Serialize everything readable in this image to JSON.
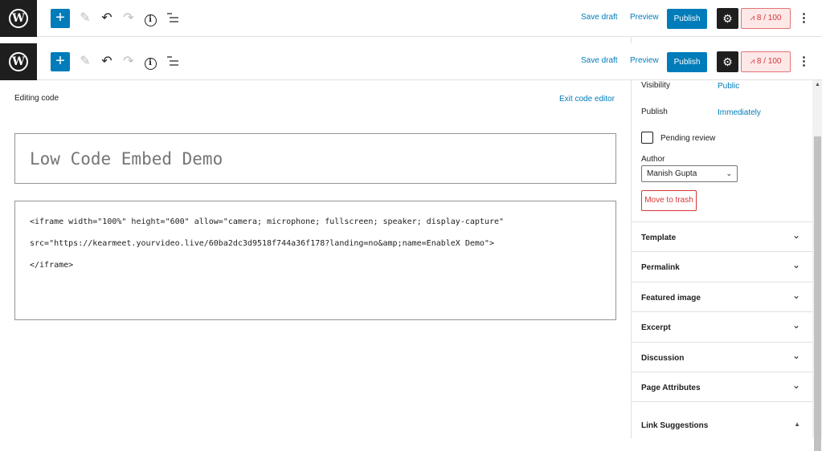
{
  "toolbar": {
    "logo_letter": "W",
    "add_symbol": "+",
    "pencil_symbol": "✎",
    "undo_symbol": "↶",
    "redo_symbol": "↷",
    "info_symbol": "i",
    "save_draft": "Save draft",
    "preview": "Preview",
    "publish": "Publish",
    "gear_symbol": "⚙",
    "score": "8 / 100",
    "more_symbol": "⋮"
  },
  "editor": {
    "mode_label": "Editing code",
    "exit_label": "Exit code editor",
    "title": "Low Code Embed Demo",
    "code_lines": [
      "<iframe width=\"100%\" height=\"600\" allow=\"camera; microphone; fullscreen; speaker; display-capture\"",
      "src=\"https://kearmeet.yourvideo.live/60ba2dc3d9518f744a36f178?landing=no&amp;name=EnableX Demo\">",
      "</iframe>"
    ]
  },
  "sidebar": {
    "visibility_label": "Visibility",
    "visibility_value": "Public",
    "publish_label": "Publish",
    "publish_value": "Immediately",
    "pending_label": "Pending review",
    "author_label": "Author",
    "author_value": "Manish Gupta",
    "trash_label": "Move to trash",
    "panels": [
      {
        "label": "Template"
      },
      {
        "label": "Permalink"
      },
      {
        "label": "Featured image"
      },
      {
        "label": "Excerpt"
      },
      {
        "label": "Discussion"
      },
      {
        "label": "Page Attributes"
      },
      {
        "label": "Link Suggestions"
      }
    ]
  },
  "colors": {
    "accent": "#007cba",
    "danger": "#d63638",
    "dark": "#1e1e1e"
  }
}
